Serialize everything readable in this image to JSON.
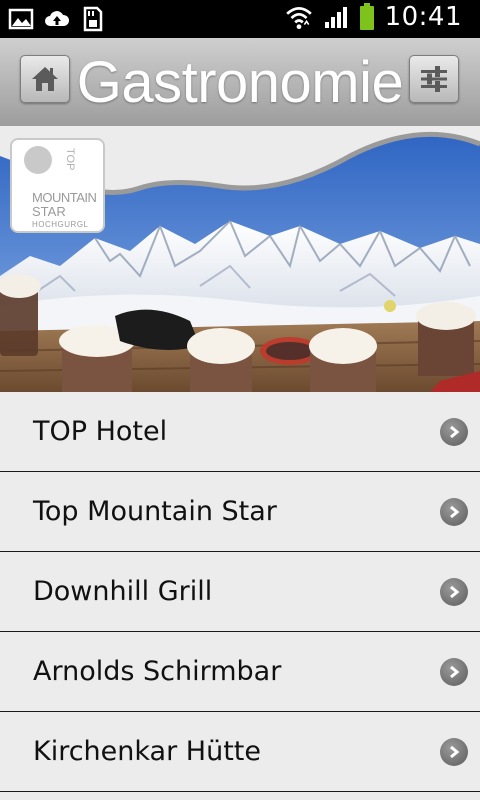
{
  "status_bar": {
    "time": "10:41",
    "icons": [
      "image-icon",
      "cloud-upload-icon",
      "sd-card-icon",
      "wifi-icon",
      "signal-icon",
      "battery-icon"
    ],
    "battery_color": "#7ec31b"
  },
  "header": {
    "title": "Gastronomie",
    "home_icon": "home-icon",
    "settings_icon": "sliders-icon"
  },
  "banner": {
    "logo": {
      "top_text": "TOP",
      "line1": "MOUNTAIN",
      "line2": "STAR",
      "line3": "HOCHGURGL"
    }
  },
  "list": {
    "items": [
      {
        "label": "TOP Hotel"
      },
      {
        "label": "Top Mountain Star"
      },
      {
        "label": "Downhill Grill"
      },
      {
        "label": "Arnolds Schirmbar"
      },
      {
        "label": "Kirchenkar Hütte"
      }
    ],
    "chevron_icon": "chevron-right-circle-icon"
  }
}
